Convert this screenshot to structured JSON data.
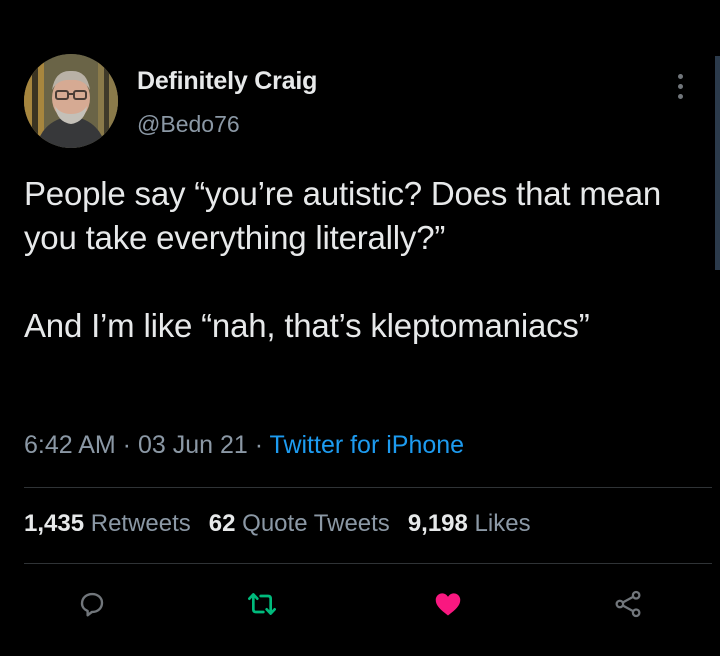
{
  "author": {
    "display_name": "Definitely Craig",
    "handle": "@Bedo76"
  },
  "tweet": {
    "paragraphs": [
      "People say “you’re autistic? Does that mean you take everything literally?”",
      "And I’m like “nah, that’s kleptomaniacs”"
    ]
  },
  "meta": {
    "time": "6:42 AM",
    "separator": " · ",
    "date": "03 Jun 21",
    "source": "Twitter for iPhone"
  },
  "stats": {
    "retweets_count": "1,435",
    "retweets_label": "Retweets",
    "quotes_count": "62",
    "quotes_label": "Quote Tweets",
    "likes_count": "9,198",
    "likes_label": "Likes"
  },
  "actions": {
    "reply_icon": "speech-bubble-icon",
    "retweet_icon": "retweet-arrows-icon",
    "like_icon": "heart-icon",
    "share_icon": "share-nodes-icon",
    "liked": true
  },
  "colors": {
    "background": "#000000",
    "primary_text": "#e7e9ea",
    "secondary_text": "#8b98a5",
    "link": "#1d9bf0",
    "retweet_green": "#00ba7c",
    "like_pink": "#f91880",
    "divider": "#2f3336"
  }
}
